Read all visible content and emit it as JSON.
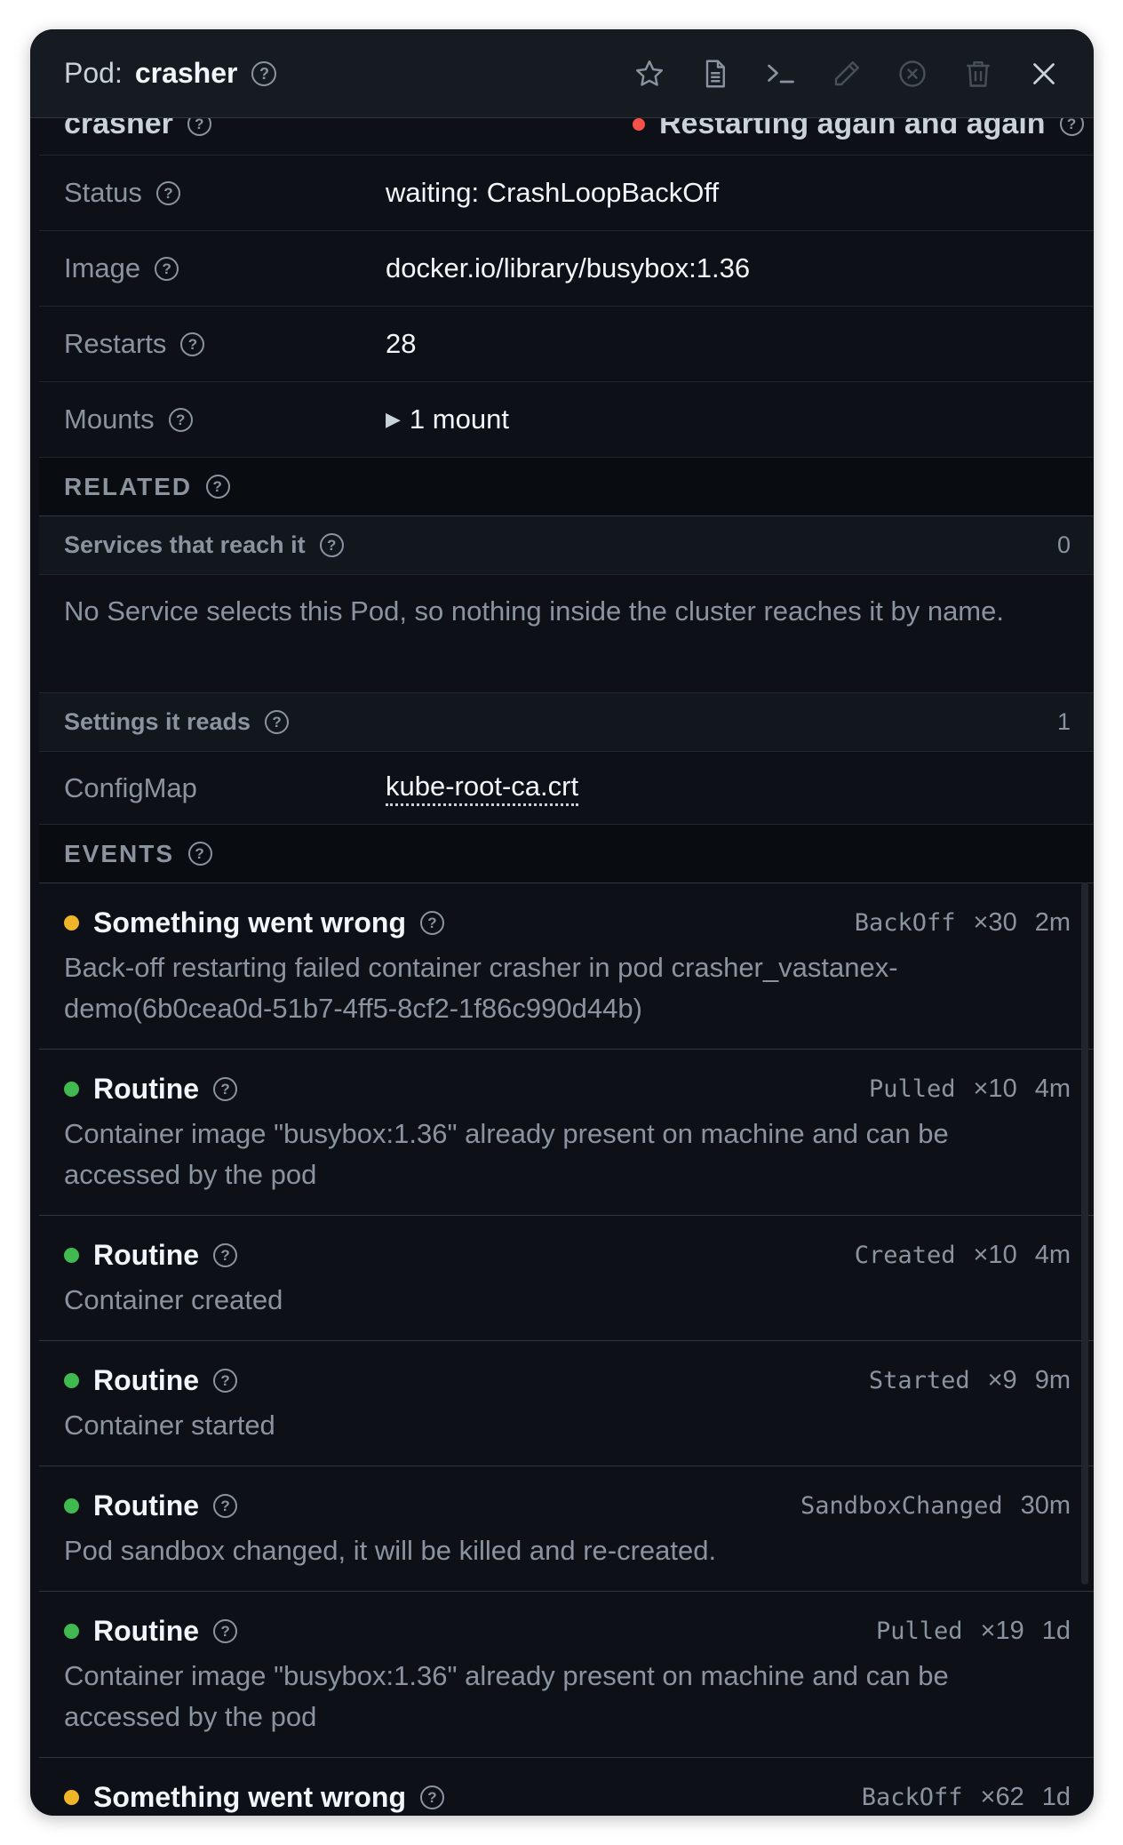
{
  "header": {
    "kind": "Pod:",
    "name": "crasher",
    "toolbar": [
      "star-icon",
      "document-icon",
      "terminal-icon",
      "pencil-icon",
      "stop-circle-icon",
      "trash-icon",
      "close-icon"
    ]
  },
  "partial_row": {
    "left": "crasher",
    "right": "Restarting again and again"
  },
  "container": {
    "rows": [
      {
        "key": "Status",
        "value": "waiting: CrashLoopBackOff"
      },
      {
        "key": "Image",
        "value": "docker.io/library/busybox:1.36"
      },
      {
        "key": "Restarts",
        "value": "28"
      },
      {
        "key": "Mounts",
        "value": "1 mount"
      }
    ]
  },
  "related": {
    "title": "RELATED",
    "services": {
      "label": "Services that reach it",
      "count": "0",
      "message": "No Service selects this Pod, so nothing inside the cluster reaches it by name."
    },
    "settings": {
      "label": "Settings it reads",
      "count": "1",
      "item_key": "ConfigMap",
      "item_value": "kube-root-ca.crt"
    }
  },
  "events": {
    "title": "EVENTS",
    "items": [
      {
        "severity": "warning",
        "title": "Something went wrong",
        "reason": "BackOff",
        "count": "×30",
        "age": "2m",
        "message": "Back-off restarting failed container crasher in pod crasher_vastanex-demo(6b0cea0d-51b7-4ff5-8cf2-1f86c990d44b)"
      },
      {
        "severity": "normal",
        "title": "Routine",
        "reason": "Pulled",
        "count": "×10",
        "age": "4m",
        "message": "Container image \"busybox:1.36\" already present on machine and can be accessed by the pod"
      },
      {
        "severity": "normal",
        "title": "Routine",
        "reason": "Created",
        "count": "×10",
        "age": "4m",
        "message": "Container created"
      },
      {
        "severity": "normal",
        "title": "Routine",
        "reason": "Started",
        "count": "×9",
        "age": "9m",
        "message": "Container started"
      },
      {
        "severity": "normal",
        "title": "Routine",
        "reason": "SandboxChanged",
        "count": "",
        "age": "30m",
        "message": "Pod sandbox changed, it will be killed and re-created."
      },
      {
        "severity": "normal",
        "title": "Routine",
        "reason": "Pulled",
        "count": "×19",
        "age": "1d",
        "message": "Container image \"busybox:1.36\" already present on machine and can be accessed by the pod"
      },
      {
        "severity": "warning",
        "title": "Something went wrong",
        "reason": "BackOff",
        "count": "×62",
        "age": "1d",
        "message": ""
      }
    ]
  },
  "colors": {
    "warning": "#f0b429",
    "normal": "#3fb950",
    "error": "#f85149"
  }
}
